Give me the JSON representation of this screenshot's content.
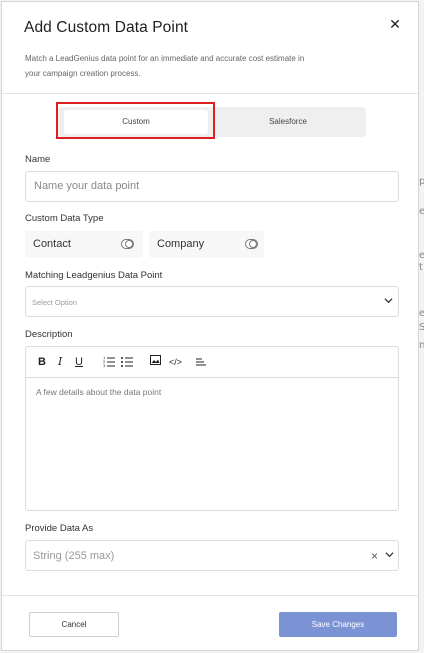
{
  "background_fragments": [
    "p",
    "e",
    "e",
    "t",
    "e",
    "S",
    "n"
  ],
  "modal": {
    "title": "Add Custom Data Point",
    "close_glyph": "✕",
    "subtitle": "Match a LeadGenius data point for an immediate and accurate cost estimate in your campaign creation process."
  },
  "tabs": {
    "items": [
      {
        "label": "Custom",
        "selected": true
      },
      {
        "label": "Salesforce",
        "selected": false
      }
    ]
  },
  "form": {
    "name": {
      "label": "Name",
      "placeholder": "Name your data point"
    },
    "custom_data_type": {
      "label": "Custom Data Type",
      "options": [
        {
          "label": "Contact",
          "on": false
        },
        {
          "label": "Company",
          "on": false
        }
      ]
    },
    "matching_data_point": {
      "label": "Matching Leadgenius Data Point",
      "placeholder": "Select Option"
    },
    "description": {
      "label": "Description",
      "placeholder": "A few details about the data point",
      "toolbar": {
        "bold": "B",
        "italic": "I",
        "underline": "U",
        "ordered_list_icon": "ordered-list-icon",
        "bullet_list_icon": "bullet-list-icon",
        "image_icon": "image-icon",
        "code_icon": "code-icon",
        "align_icon": "align-icon"
      }
    },
    "provide_data_as": {
      "label": "Provide Data As",
      "value": "String (255 max)"
    }
  },
  "footer": {
    "cancel_label": "Cancel",
    "save_label": "Save Changes"
  },
  "colors": {
    "primary_button": "#7b93d5",
    "highlight": "#e02020"
  }
}
